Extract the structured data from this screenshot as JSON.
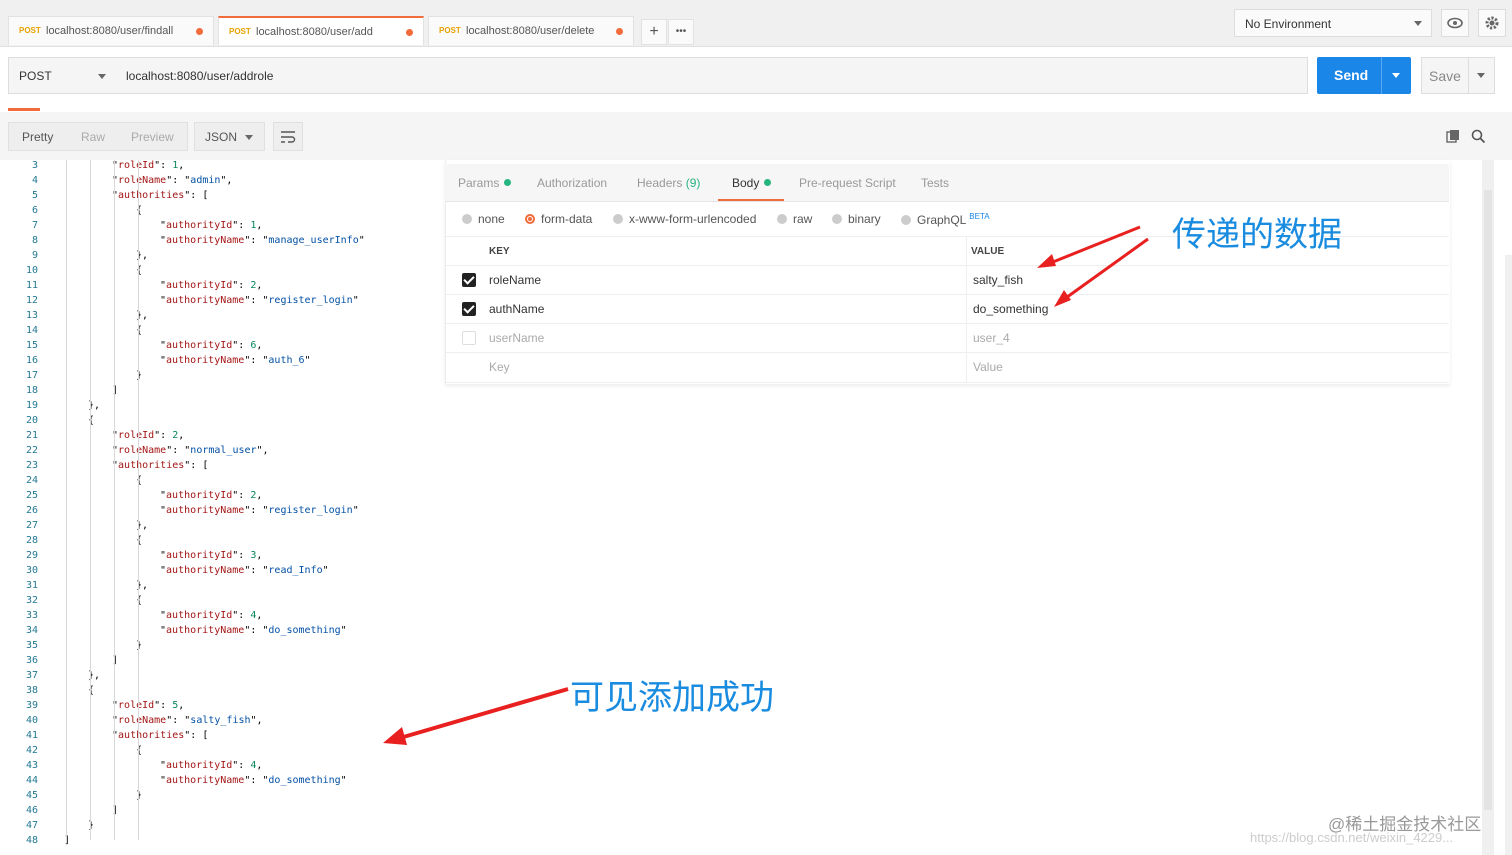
{
  "tabs": [
    {
      "method": "POST",
      "url": "localhost:8080/user/findall"
    },
    {
      "method": "POST",
      "url": "localhost:8080/user/add"
    },
    {
      "method": "POST",
      "url": "localhost:8080/user/delete"
    }
  ],
  "tab_actions": {
    "new": "+",
    "more": "•••"
  },
  "environment": {
    "selected": "No Environment"
  },
  "request": {
    "method": "POST",
    "url": "localhost:8080/user/addrole",
    "send_label": "Send",
    "save_label": "Save"
  },
  "response_toolbar": {
    "views": [
      "Pretty",
      "Raw",
      "Preview"
    ],
    "format": "JSON"
  },
  "request_tabs": {
    "params": "Params",
    "authorization": "Authorization",
    "headers": "Headers",
    "headers_count": "(9)",
    "body": "Body",
    "prerequest": "Pre-request Script",
    "tests": "Tests"
  },
  "body_types": {
    "none": "none",
    "form_data": "form-data",
    "urlencoded": "x-www-form-urlencoded",
    "raw": "raw",
    "binary": "binary",
    "graphql": "GraphQL",
    "beta": "BETA",
    "selected": "form-data"
  },
  "form_table": {
    "headers": {
      "key": "KEY",
      "value": "VALUE"
    },
    "rows": [
      {
        "key": "roleName",
        "value": "salty_fish",
        "checked": true
      },
      {
        "key": "authName",
        "value": "do_something",
        "checked": true
      },
      {
        "key": "userName",
        "value": "user_4",
        "checked": false
      }
    ],
    "placeholder": {
      "key": "Key",
      "value": "Value"
    }
  },
  "code": {
    "line_numbers": [
      "3",
      "4",
      "5",
      "6",
      "7",
      "8",
      "9",
      "10",
      "11",
      "12",
      "13",
      "14",
      "15",
      "16",
      "17",
      "18",
      "19",
      "20",
      "21",
      "22",
      "23",
      "24",
      "25",
      "26",
      "27",
      "28",
      "29",
      "30",
      "31",
      "32",
      "33",
      "34",
      "35",
      "36",
      "37",
      "38",
      "39",
      "40",
      "41",
      "42",
      "43",
      "44",
      "45",
      "46",
      "47",
      "48"
    ],
    "lines": [
      {
        "indent": 2,
        "key": "roleId",
        "num": "1"
      },
      {
        "indent": 2,
        "key": "roleName",
        "str": "admin"
      },
      {
        "indent": 2,
        "key": "authorities",
        "open": "["
      },
      {
        "indent": 3,
        "raw": "{"
      },
      {
        "indent": 4,
        "key": "authorityId",
        "num": "1"
      },
      {
        "indent": 4,
        "key": "authorityName",
        "str": "manage_userInfo",
        "last": true
      },
      {
        "indent": 3,
        "raw": "},"
      },
      {
        "indent": 3,
        "raw": "{"
      },
      {
        "indent": 4,
        "key": "authorityId",
        "num": "2"
      },
      {
        "indent": 4,
        "key": "authorityName",
        "str": "register_login",
        "last": true
      },
      {
        "indent": 3,
        "raw": "},"
      },
      {
        "indent": 3,
        "raw": "{"
      },
      {
        "indent": 4,
        "key": "authorityId",
        "num": "6"
      },
      {
        "indent": 4,
        "key": "authorityName",
        "str": "auth_6",
        "last": true
      },
      {
        "indent": 3,
        "raw": "}"
      },
      {
        "indent": 2,
        "raw": "]"
      },
      {
        "indent": 1,
        "raw": "},"
      },
      {
        "indent": 1,
        "raw": "{"
      },
      {
        "indent": 2,
        "key": "roleId",
        "num": "2"
      },
      {
        "indent": 2,
        "key": "roleName",
        "str": "normal_user"
      },
      {
        "indent": 2,
        "key": "authorities",
        "open": "["
      },
      {
        "indent": 3,
        "raw": "{"
      },
      {
        "indent": 4,
        "key": "authorityId",
        "num": "2"
      },
      {
        "indent": 4,
        "key": "authorityName",
        "str": "register_login",
        "last": true
      },
      {
        "indent": 3,
        "raw": "},"
      },
      {
        "indent": 3,
        "raw": "{"
      },
      {
        "indent": 4,
        "key": "authorityId",
        "num": "3"
      },
      {
        "indent": 4,
        "key": "authorityName",
        "str": "read_Info",
        "last": true
      },
      {
        "indent": 3,
        "raw": "},"
      },
      {
        "indent": 3,
        "raw": "{"
      },
      {
        "indent": 4,
        "key": "authorityId",
        "num": "4"
      },
      {
        "indent": 4,
        "key": "authorityName",
        "str": "do_something",
        "last": true
      },
      {
        "indent": 3,
        "raw": "}"
      },
      {
        "indent": 2,
        "raw": "]"
      },
      {
        "indent": 1,
        "raw": "},"
      },
      {
        "indent": 1,
        "raw": "{"
      },
      {
        "indent": 2,
        "key": "roleId",
        "num": "5"
      },
      {
        "indent": 2,
        "key": "roleName",
        "str": "salty_fish"
      },
      {
        "indent": 2,
        "key": "authorities",
        "open": "["
      },
      {
        "indent": 3,
        "raw": "{"
      },
      {
        "indent": 4,
        "key": "authorityId",
        "num": "4"
      },
      {
        "indent": 4,
        "key": "authorityName",
        "str": "do_something",
        "last": true
      },
      {
        "indent": 3,
        "raw": "}"
      },
      {
        "indent": 2,
        "raw": "]"
      },
      {
        "indent": 1,
        "raw": "}"
      },
      {
        "indent": 0,
        "raw": "]"
      }
    ]
  },
  "annotations": {
    "data_sent": "传递的数据",
    "added_success": "可见添加成功"
  },
  "watermark": {
    "text": "@稀土掘金技术社区",
    "url": "https://blog.csdn.net/weixin_4229..."
  },
  "colors": {
    "accent": "#f26b3a",
    "send": "#1a86e8",
    "annotation": "#1a8ce0",
    "arrow": "#e8201f",
    "ok_dot": "#26b47f"
  }
}
